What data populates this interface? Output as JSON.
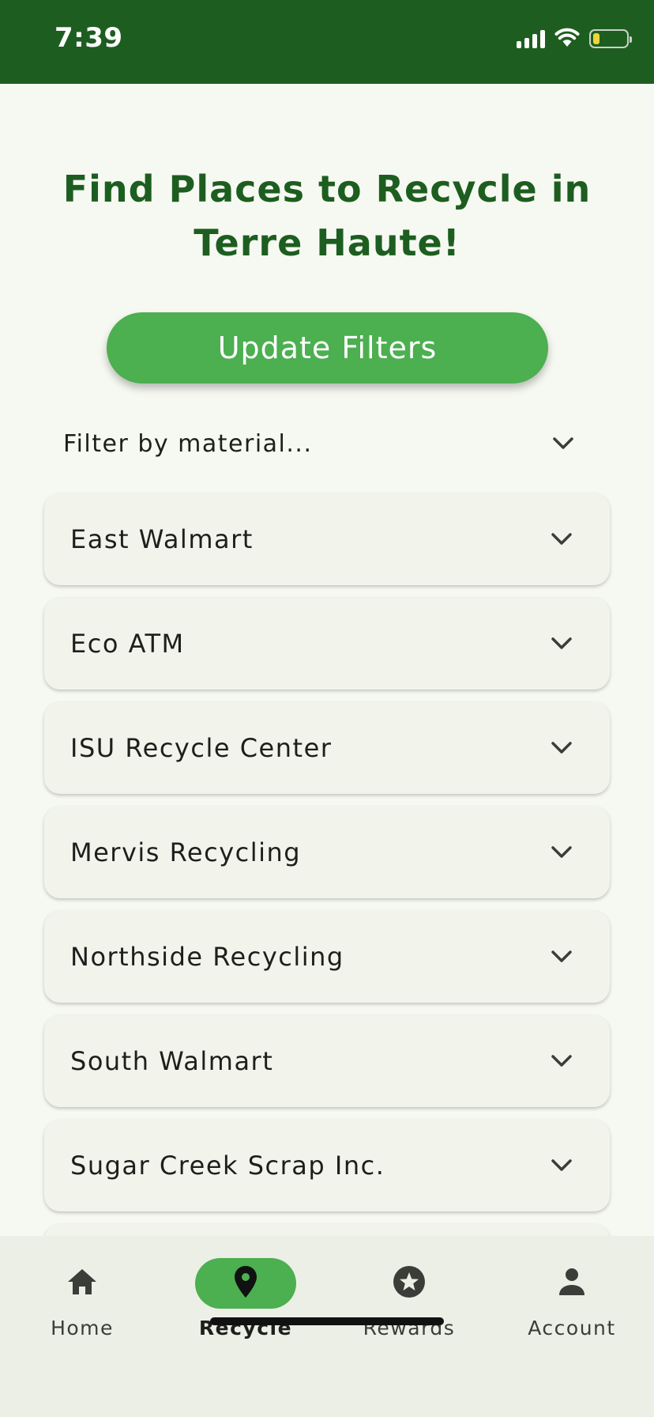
{
  "status_bar": {
    "time": "7:39",
    "bg_color": "#1d5e20",
    "battery_level": 0.2,
    "battery_color": "#f2d23b"
  },
  "page": {
    "title": "Find Places to Recycle in Terre Haute!"
  },
  "update_button": {
    "label": "Update Filters",
    "color": "#4caf50"
  },
  "filter": {
    "placeholder": "Filter by material..."
  },
  "locations": [
    {
      "name": "East Walmart"
    },
    {
      "name": "Eco ATM"
    },
    {
      "name": "ISU Recycle Center"
    },
    {
      "name": "Mervis Recycling"
    },
    {
      "name": "Northside Recycling"
    },
    {
      "name": "South Walmart"
    },
    {
      "name": "Sugar Creek Scrap Inc."
    },
    {
      "name": ""
    }
  ],
  "nav": {
    "active_color": "#4caf50",
    "items": [
      {
        "label": "Home",
        "icon": "home-icon"
      },
      {
        "label": "Recycle",
        "icon": "location-pin-icon",
        "active": true
      },
      {
        "label": "Rewards",
        "icon": "star-badge-icon"
      },
      {
        "label": "Account",
        "icon": "person-icon"
      }
    ]
  }
}
